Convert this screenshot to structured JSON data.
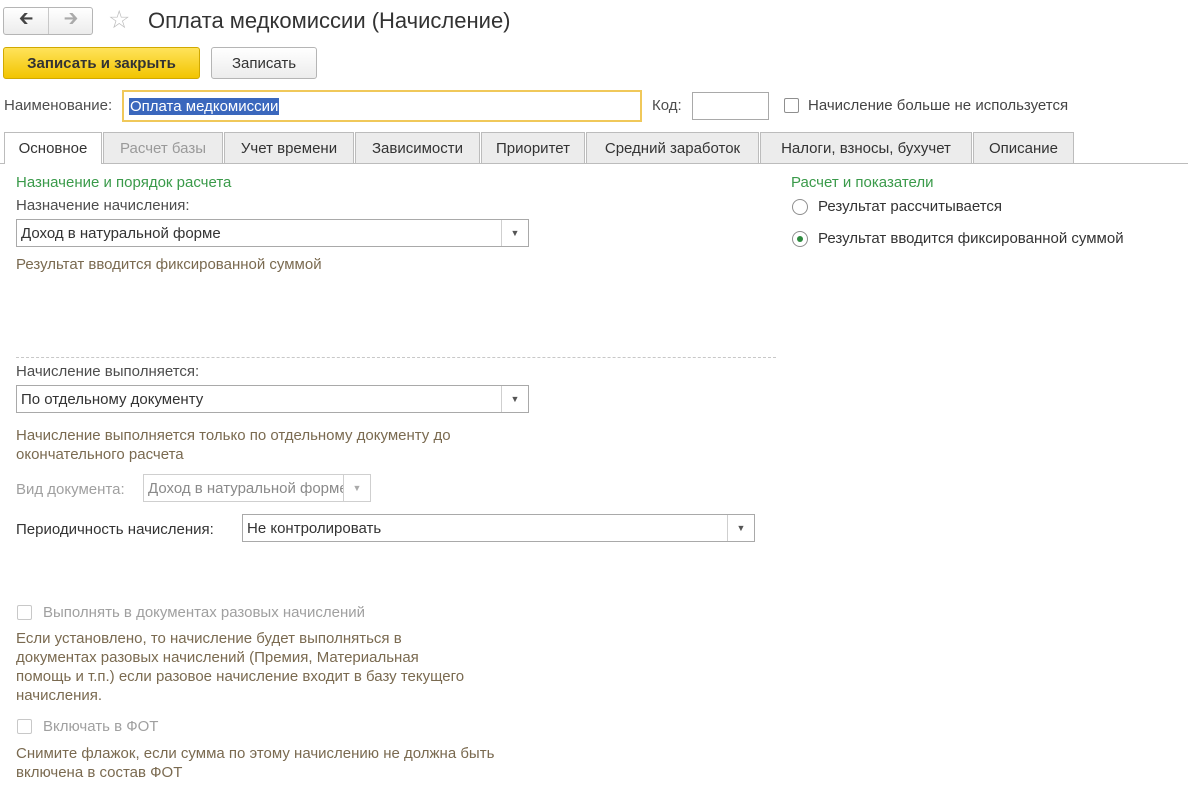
{
  "window": {
    "title": "Оплата медкомиссии (Начисление)"
  },
  "toolbar": {
    "save_close_label": "Записать и закрыть",
    "save_label": "Записать"
  },
  "header": {
    "name_label": "Наименование:",
    "name_value": "Оплата медкомиссии",
    "code_label": "Код:",
    "code_value": "",
    "unused_label": "Начисление больше не используется"
  },
  "tabs": [
    {
      "label": "Основное"
    },
    {
      "label": "Расчет базы"
    },
    {
      "label": "Учет времени"
    },
    {
      "label": "Зависимости"
    },
    {
      "label": "Приоритет"
    },
    {
      "label": "Средний заработок"
    },
    {
      "label": "Налоги, взносы, бухучет"
    },
    {
      "label": "Описание"
    }
  ],
  "main": {
    "section_title": "Назначение и порядок расчета",
    "purpose_label": "Назначение начисления:",
    "purpose_value": "Доход в натуральной форме",
    "purpose_hint": "Результат вводится фиксированной суммой",
    "execution_label": "Начисление выполняется:",
    "execution_value": "По отдельному документу",
    "execution_hint": "Начисление выполняется только по отдельному документу до окончательного расчета",
    "doc_type_label": "Вид документа:",
    "doc_type_value": "Доход в натуральной форме",
    "periodicity_label": "Периодичность начисления:",
    "periodicity_value": "Не контролировать",
    "one_time_label": "Выполнять в документах разовых начислений",
    "one_time_hint": "Если установлено, то начисление будет выполняться в документах разовых начислений (Премия, Материальная помощь и т.п.) если разовое начисление входит в базу текущего начисления.",
    "fot_label": "Включать в ФОТ",
    "fot_hint": "Снимите флажок, если сумма по этому начислению не должна быть включена в состав ФОТ"
  },
  "right": {
    "section_title": "Расчет и показатели",
    "radio_calculated": "Результат рассчитывается",
    "radio_fixed": "Результат вводится фиксированной суммой"
  },
  "colors": {
    "accent_yellow": "#f2c500",
    "section_green": "#3a9a4a",
    "hint_brown": "#7a6a50",
    "selection_blue": "#3a67bd"
  },
  "icons": {
    "back": "arrow-left-icon",
    "forward": "arrow-right-icon",
    "favorite": "star-icon",
    "dropdown": "triangle-down-icon"
  }
}
